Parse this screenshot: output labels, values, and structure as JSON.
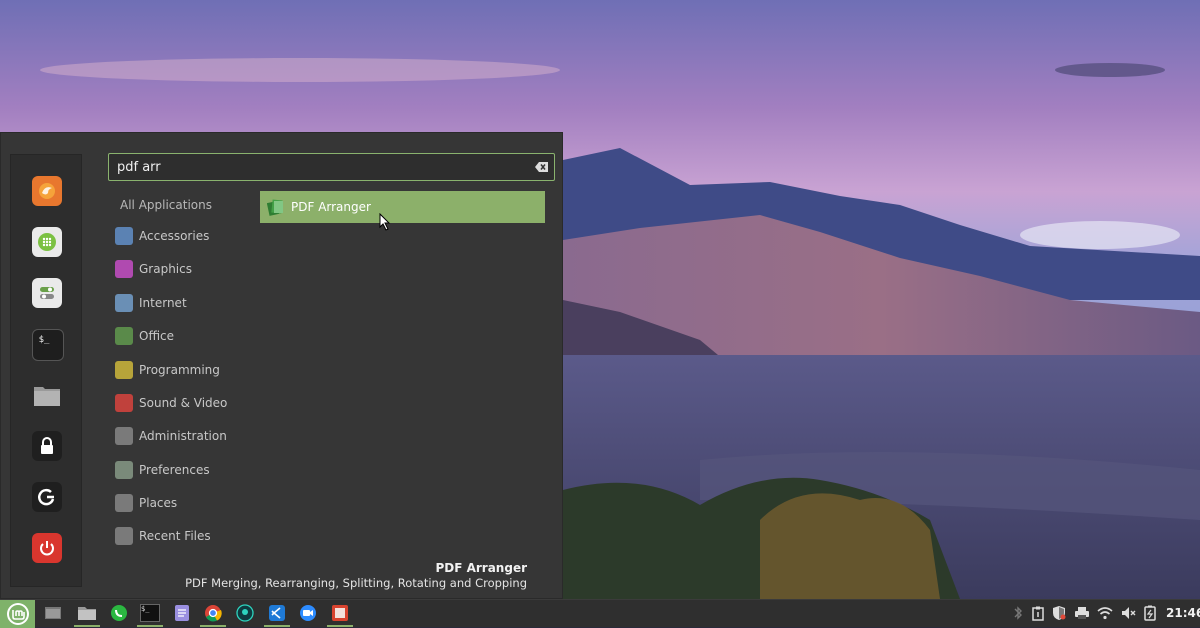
{
  "search": {
    "value": "pdf arr"
  },
  "categories": {
    "all": "All Applications",
    "items": [
      {
        "label": "Accessories",
        "icon": "accessories-icon",
        "color": "#5b82b3"
      },
      {
        "label": "Graphics",
        "icon": "graphics-icon",
        "color": "#b04ab0"
      },
      {
        "label": "Internet",
        "icon": "internet-icon",
        "color": "#6a8fb5"
      },
      {
        "label": "Office",
        "icon": "office-icon",
        "color": "#5a8a4a"
      },
      {
        "label": "Programming",
        "icon": "programming-icon",
        "color": "#b7a43a"
      },
      {
        "label": "Sound & Video",
        "icon": "sound-video-icon",
        "color": "#c0413c"
      },
      {
        "label": "Administration",
        "icon": "administration-icon",
        "color": "#7a7a7a"
      },
      {
        "label": "Preferences",
        "icon": "preferences-icon",
        "color": "#7a8a7a"
      },
      {
        "label": "Places",
        "icon": "places-folder-icon",
        "color": "#7a7a7a"
      },
      {
        "label": "Recent Files",
        "icon": "recent-files-icon",
        "color": "#7a7a7a"
      }
    ]
  },
  "results": [
    {
      "label": "PDF Arranger",
      "icon": "pdf-arranger-icon",
      "highlight": "#8cb06a"
    }
  ],
  "description": {
    "name": "PDF Arranger",
    "text": "PDF Merging, Rearranging, Splitting, Rotating and Cropping"
  },
  "favorites": [
    "firefox-icon",
    "software-manager-icon",
    "system-settings-icon",
    "terminal-icon",
    "files-icon",
    "lock-screen-icon",
    "logout-icon",
    "power-icon"
  ],
  "taskbar": {
    "apps": [
      "show-desktop-icon",
      "files-icon",
      "whatsapp-icon",
      "terminal-icon",
      "text-editor-icon",
      "chrome-icon",
      "gitkraken-icon",
      "vscode-icon",
      "zoom-icon",
      "pdf-arranger-icon"
    ],
    "tray": [
      "bluetooth-icon",
      "clipboard-icon",
      "shield-icon",
      "printer-icon",
      "wifi-icon",
      "volume-icon",
      "battery-icon"
    ],
    "clock": "21:46"
  },
  "colors": {
    "accent": "#8cb06a",
    "menu_bg": "#363636",
    "taskbar_bg": "#2f2f2f"
  }
}
